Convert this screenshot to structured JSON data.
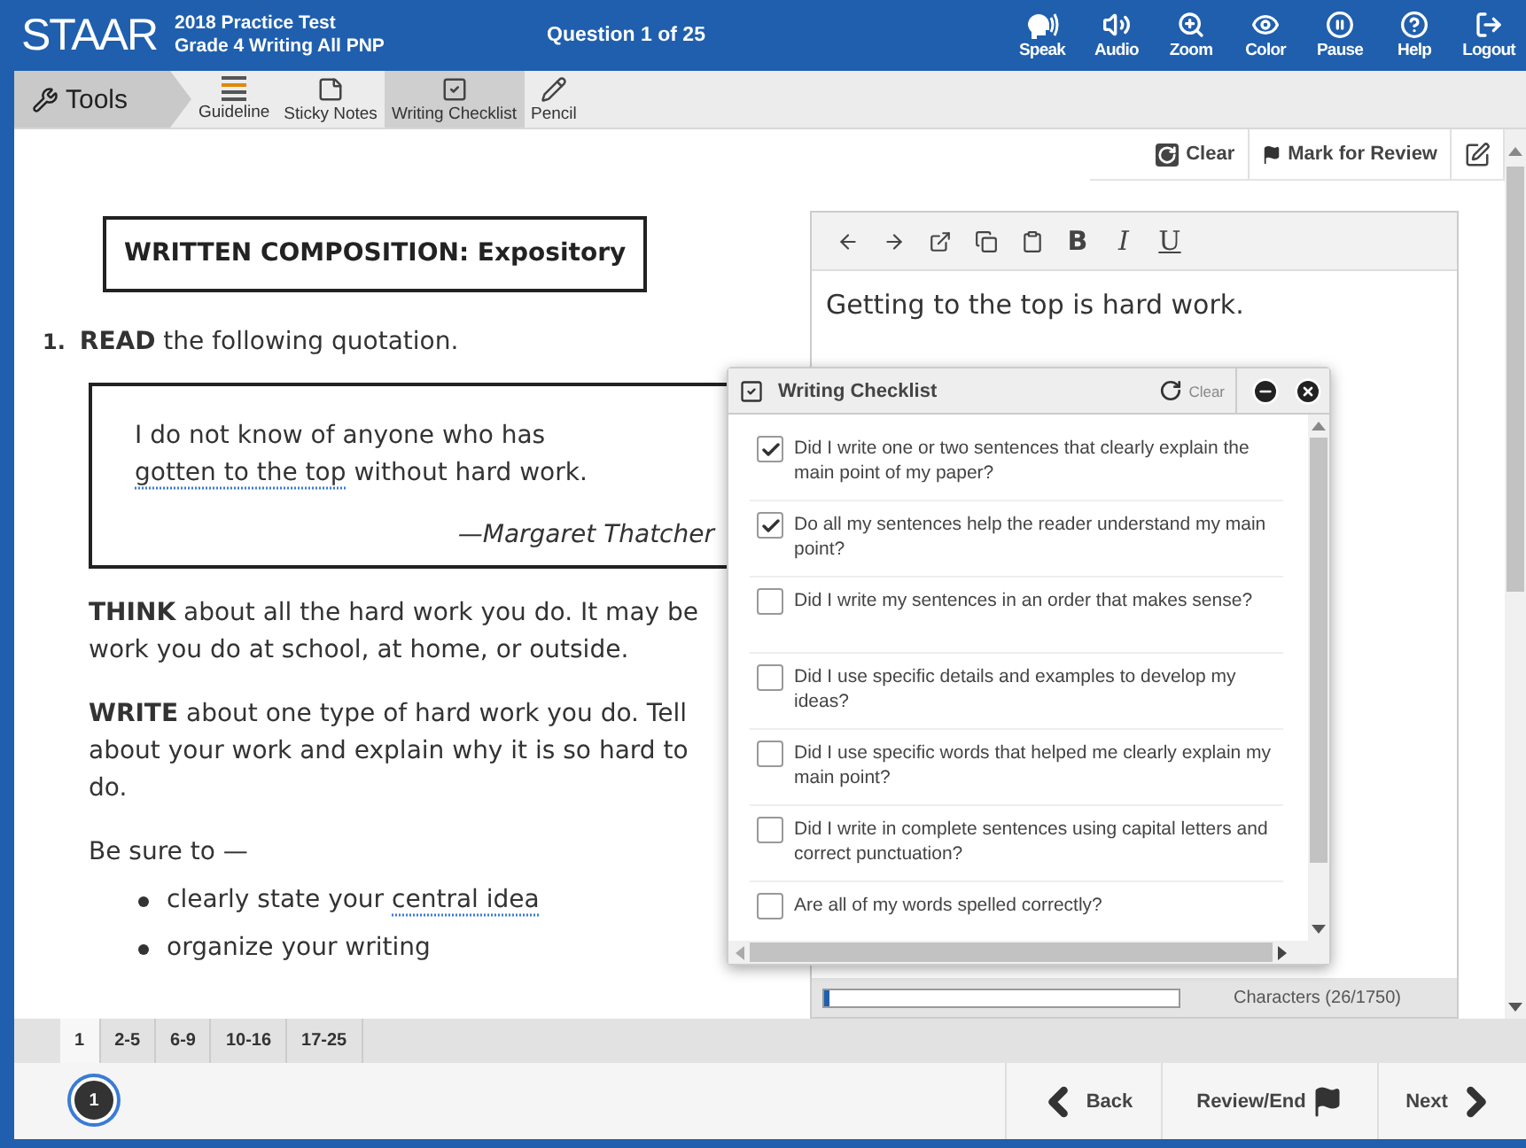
{
  "header": {
    "logo": "STAAR",
    "test_name": "2018 Practice Test",
    "test_subtitle": "Grade 4 Writing All PNP",
    "question_label": "Question 1 of 25",
    "tools": [
      {
        "label": "Speak",
        "kind": "speak"
      },
      {
        "label": "Audio",
        "kind": "audio"
      },
      {
        "label": "Zoom",
        "kind": "zoom"
      },
      {
        "label": "Color",
        "kind": "color"
      },
      {
        "label": "Pause",
        "kind": "pause"
      },
      {
        "label": "Help",
        "kind": "help"
      },
      {
        "label": "Logout",
        "kind": "logout"
      }
    ]
  },
  "toolbar": {
    "tools_label": "Tools",
    "items": [
      {
        "label": "Guideline",
        "kind": "guideline",
        "selected": false
      },
      {
        "label": "Sticky Notes",
        "kind": "note",
        "selected": false
      },
      {
        "label": "Writing Checklist",
        "kind": "checklist",
        "selected": true
      },
      {
        "label": "Pencil",
        "kind": "pencil",
        "selected": false
      }
    ]
  },
  "question_actions": {
    "clear": "Clear",
    "mark": "Mark for Review"
  },
  "passage": {
    "heading": "WRITTEN COMPOSITION: Expository",
    "number": "1.",
    "prompt": "**READ** the following quotation.",
    "quote": {
      "lines": [
        [
          {
            "text": "I do not know of anyone who has",
            "underlined": false
          }
        ],
        [
          {
            "text": "gotten to the top",
            "underlined": true
          },
          {
            "text": " without hard work.",
            "underlined": false
          }
        ]
      ],
      "attribution": "—Margaret Thatcher"
    },
    "paragraphs": [
      "**THINK** about all the hard work you do. It may be work you do at school, at home, or outside.",
      "**WRITE** about one type of hard work you do. Tell about your work and explain why it is so hard to do.",
      "Be sure to —"
    ],
    "bullets": [
      [
        {
          "text": "clearly state your ",
          "underlined": false
        },
        {
          "text": "central idea",
          "underlined": true
        }
      ],
      [
        {
          "text": "organize your writing",
          "underlined": false
        }
      ]
    ]
  },
  "editor": {
    "toolbar": [
      {
        "kind": "undo"
      },
      {
        "kind": "redo"
      },
      {
        "kind": "export"
      },
      {
        "kind": "copy"
      },
      {
        "kind": "paste"
      },
      {
        "kind": "bold",
        "label": "B"
      },
      {
        "kind": "italic",
        "label": "I"
      },
      {
        "kind": "underline",
        "label": "U"
      }
    ],
    "text": "Getting to the top is hard work.",
    "characters": "Characters (26/1750)",
    "level": 0.015
  },
  "checklist": {
    "title": "Writing Checklist",
    "clear": "Clear",
    "items": [
      {
        "text": "Did I write one or two sentences that clearly explain the main point of my paper?",
        "checked": true
      },
      {
        "text": "Do all my sentences help the reader understand my main point?",
        "checked": true
      },
      {
        "text": "Did I write my sentences in an order that makes sense?",
        "checked": false
      },
      {
        "text": "Did I use specific details and examples to develop my ideas?",
        "checked": false
      },
      {
        "text": "Did I use specific words that helped me clearly explain my main point?",
        "checked": false
      },
      {
        "text": "Did I write in complete sentences using capital letters and correct punctuation?",
        "checked": false
      },
      {
        "text": "Are all of my words spelled correctly?",
        "checked": false
      }
    ]
  },
  "pages": [
    {
      "label": "1",
      "selected": true
    },
    {
      "label": "2-5",
      "selected": false
    },
    {
      "label": "6-9",
      "selected": false
    },
    {
      "label": "10-16",
      "selected": false
    },
    {
      "label": "17-25",
      "selected": false
    }
  ],
  "footer": {
    "current": "1",
    "back": "Back",
    "review": "Review/End",
    "next": "Next"
  }
}
